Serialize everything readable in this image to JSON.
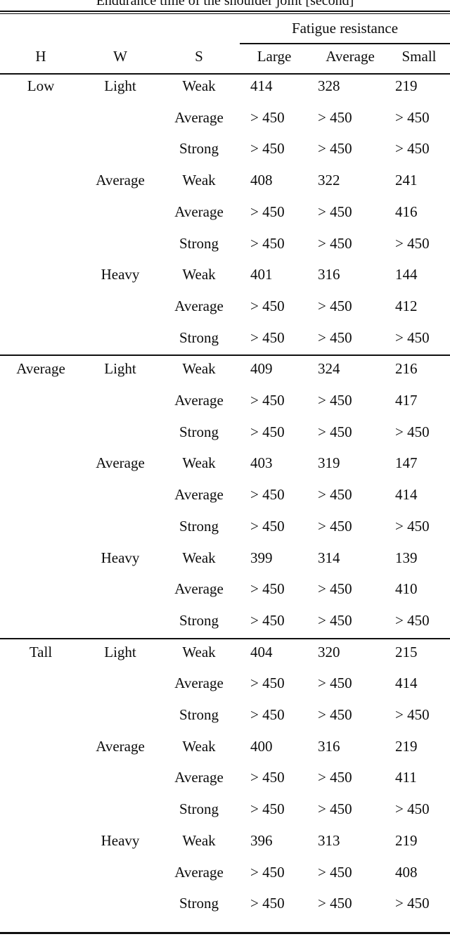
{
  "caption": "Endurance time of the shoulder joint [second]",
  "header": {
    "spanning_label": "Fatigue resistance",
    "columns": [
      "H",
      "W",
      "S",
      "Large",
      "Average",
      "Small"
    ]
  },
  "table_data": {
    "type": "table",
    "title": "Endurance time of the shoulder joint [second]",
    "group_header": "Fatigue resistance",
    "row_key_headers": [
      "H",
      "W",
      "S"
    ],
    "value_headers": [
      "Large",
      "Average",
      "Small"
    ],
    "sections": [
      {
        "h": "Low",
        "groups": [
          {
            "w": "Light",
            "rows": [
              {
                "s": "Weak",
                "values": [
                  "414",
                  "328",
                  "219"
                ]
              },
              {
                "s": "Average",
                "values": [
                  "> 450",
                  "> 450",
                  "> 450"
                ]
              },
              {
                "s": "Strong",
                "values": [
                  "> 450",
                  "> 450",
                  "> 450"
                ]
              }
            ]
          },
          {
            "w": "Average",
            "rows": [
              {
                "s": "Weak",
                "values": [
                  "408",
                  "322",
                  "241"
                ]
              },
              {
                "s": "Average",
                "values": [
                  "> 450",
                  "> 450",
                  "416"
                ]
              },
              {
                "s": "Strong",
                "values": [
                  "> 450",
                  "> 450",
                  "> 450"
                ]
              }
            ]
          },
          {
            "w": "Heavy",
            "rows": [
              {
                "s": "Weak",
                "values": [
                  "401",
                  "316",
                  "144"
                ]
              },
              {
                "s": "Average",
                "values": [
                  "> 450",
                  "> 450",
                  "412"
                ]
              },
              {
                "s": "Strong",
                "values": [
                  "> 450",
                  "> 450",
                  "> 450"
                ]
              }
            ]
          }
        ]
      },
      {
        "h": "Average",
        "groups": [
          {
            "w": "Light",
            "rows": [
              {
                "s": "Weak",
                "values": [
                  "409",
                  "324",
                  "216"
                ]
              },
              {
                "s": "Average",
                "values": [
                  "> 450",
                  "> 450",
                  "417"
                ]
              },
              {
                "s": "Strong",
                "values": [
                  "> 450",
                  "> 450",
                  "> 450"
                ]
              }
            ]
          },
          {
            "w": "Average",
            "rows": [
              {
                "s": "Weak",
                "values": [
                  "403",
                  "319",
                  "147"
                ]
              },
              {
                "s": "Average",
                "values": [
                  "> 450",
                  "> 450",
                  "414"
                ]
              },
              {
                "s": "Strong",
                "values": [
                  "> 450",
                  "> 450",
                  "> 450"
                ]
              }
            ]
          },
          {
            "w": "Heavy",
            "rows": [
              {
                "s": "Weak",
                "values": [
                  "399",
                  "314",
                  "139"
                ]
              },
              {
                "s": "Average",
                "values": [
                  "> 450",
                  "> 450",
                  "410"
                ]
              },
              {
                "s": "Strong",
                "values": [
                  "> 450",
                  "> 450",
                  "> 450"
                ]
              }
            ]
          }
        ]
      },
      {
        "h": "Tall",
        "groups": [
          {
            "w": "Light",
            "rows": [
              {
                "s": "Weak",
                "values": [
                  "404",
                  "320",
                  "215"
                ]
              },
              {
                "s": "Average",
                "values": [
                  "> 450",
                  "> 450",
                  "414"
                ]
              },
              {
                "s": "Strong",
                "values": [
                  "> 450",
                  "> 450",
                  "> 450"
                ]
              }
            ]
          },
          {
            "w": "Average",
            "rows": [
              {
                "s": "Weak",
                "values": [
                  "400",
                  "316",
                  "219"
                ]
              },
              {
                "s": "Average",
                "values": [
                  "> 450",
                  "> 450",
                  "411"
                ]
              },
              {
                "s": "Strong",
                "values": [
                  "> 450",
                  "> 450",
                  "> 450"
                ]
              }
            ]
          },
          {
            "w": "Heavy",
            "rows": [
              {
                "s": "Weak",
                "values": [
                  "396",
                  "313",
                  "219"
                ]
              },
              {
                "s": "Average",
                "values": [
                  "> 450",
                  "> 450",
                  "408"
                ]
              },
              {
                "s": "Strong",
                "values": [
                  "> 450",
                  "> 450",
                  "> 450"
                ]
              }
            ]
          }
        ]
      }
    ]
  }
}
